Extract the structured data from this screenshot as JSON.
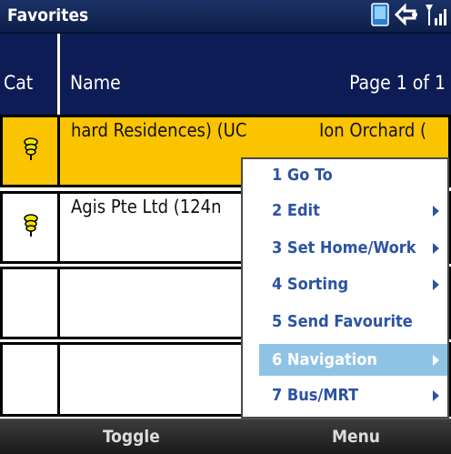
{
  "titlebar": {
    "title": "Favorites",
    "status_icons": [
      "phone-screen-icon",
      "connection-icon",
      "signal-strength-icon"
    ]
  },
  "table": {
    "header": {
      "cat": "Cat",
      "name": "Name",
      "page": "Page 1 of 1"
    },
    "rows": [
      {
        "icon": "pushpin-icon",
        "name": "hard Residences) (UC",
        "address": "Ion Orchard (",
        "selected": true
      },
      {
        "icon": "pushpin-icon",
        "name": "Agis Pte Ltd (124n",
        "address": "",
        "selected": false
      },
      {
        "icon": "",
        "name": "",
        "address": "",
        "selected": false
      },
      {
        "icon": "",
        "name": "",
        "address": "",
        "selected": false
      }
    ]
  },
  "menu": {
    "items": [
      {
        "label": "1 Go To",
        "submenu": false,
        "selected": false
      },
      {
        "label": "2 Edit",
        "submenu": true,
        "selected": false
      },
      {
        "label": "3 Set Home/Work",
        "submenu": true,
        "selected": false
      },
      {
        "label": "4 Sorting",
        "submenu": true,
        "selected": false
      },
      {
        "label": "5 Send Favourite",
        "submenu": false,
        "selected": false
      },
      {
        "label": "6 Navigation",
        "submenu": true,
        "selected": true
      },
      {
        "label": "7 Bus/MRT",
        "submenu": true,
        "selected": false
      }
    ]
  },
  "softkeys": {
    "left": "Toggle",
    "right": "Menu"
  },
  "colors": {
    "titlebar": "#0e1f4a",
    "header": "#0d1c55",
    "selected_row": "#fbc400",
    "menu_text": "#2c53a3",
    "menu_highlight": "#8fc3e6",
    "softkey_bar": "#2a2a2a"
  }
}
